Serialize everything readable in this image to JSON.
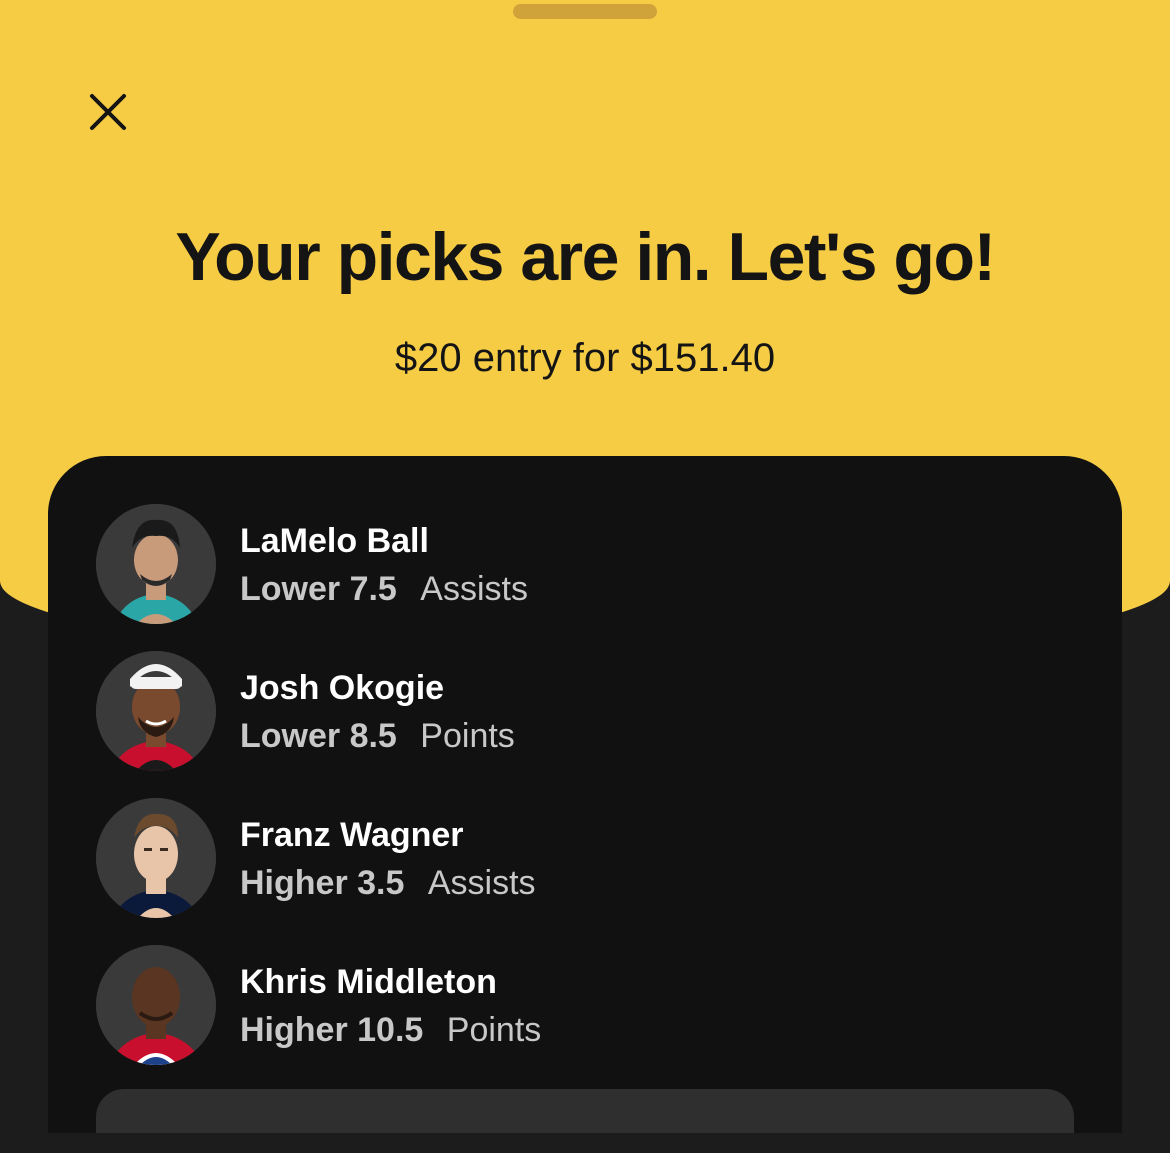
{
  "header": {
    "title": "Your picks are in. Let's go!",
    "entry_summary": "$20 entry for $151.40"
  },
  "icons": {
    "close": "close-icon",
    "handle": "grab-handle"
  },
  "colors": {
    "accent_yellow": "#f6cc45",
    "card_dark": "#111111",
    "background_dark": "#1c1c1c",
    "text_dark": "#141414",
    "text_light": "#ffffff",
    "text_muted": "#c8c8c8"
  },
  "picks": [
    {
      "player": "LaMelo Ball",
      "direction": "Lower",
      "line": "7.5",
      "stat": "Assists",
      "jersey_color": "#2aa6a6"
    },
    {
      "player": "Josh Okogie",
      "direction": "Lower",
      "line": "8.5",
      "stat": "Points",
      "jersey_color": "#c8102e"
    },
    {
      "player": "Franz Wagner",
      "direction": "Higher",
      "line": "3.5",
      "stat": "Assists",
      "jersey_color": "#0b1a3a"
    },
    {
      "player": "Khris Middleton",
      "direction": "Higher",
      "line": "10.5",
      "stat": "Points",
      "jersey_color": "#c8102e"
    }
  ]
}
